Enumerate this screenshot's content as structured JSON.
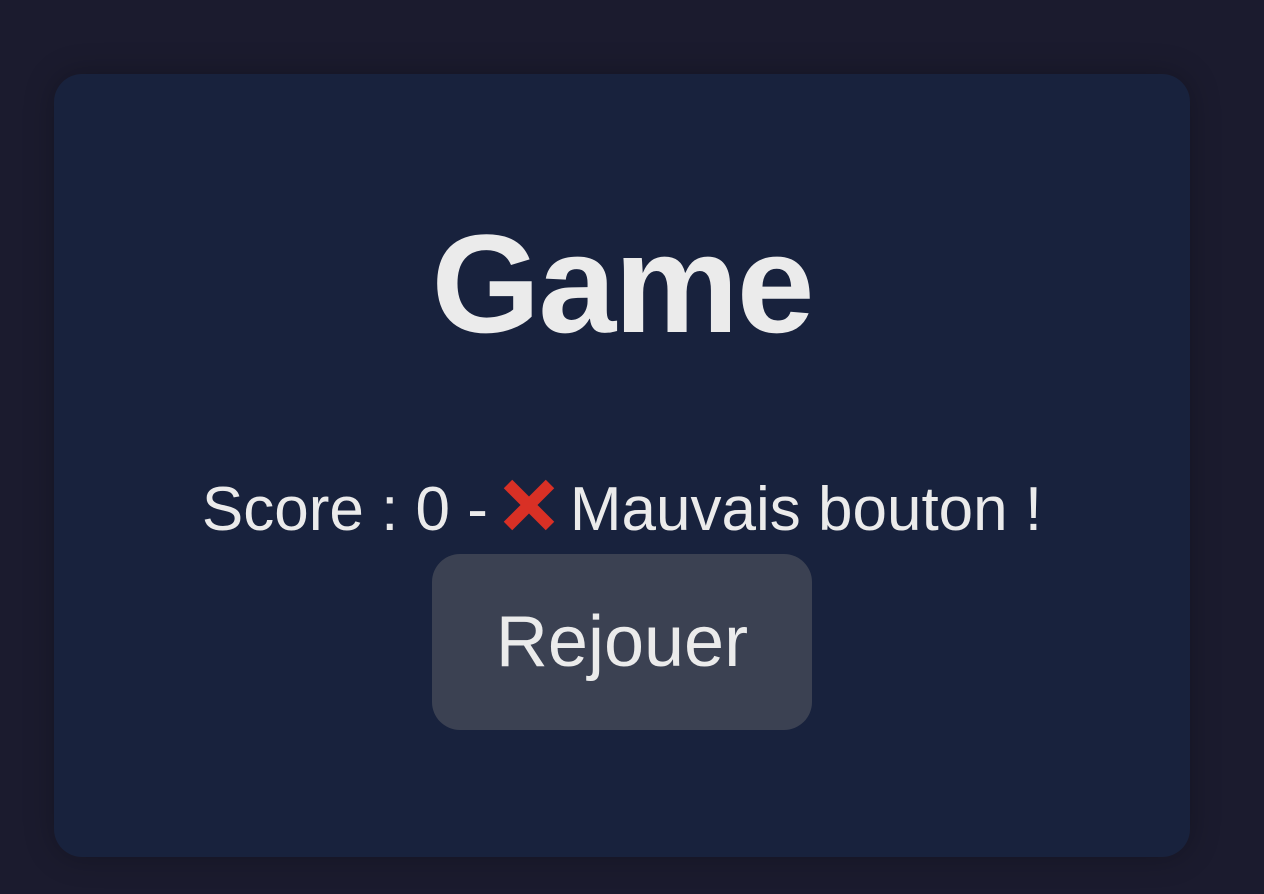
{
  "game": {
    "title": "Game",
    "score_prefix": "Score : 0 -",
    "message": "Mauvais bouton !",
    "status_icon": "cross-mark-icon",
    "replay_label": "Rejouer"
  },
  "colors": {
    "background": "#1b1b2e",
    "card": "#18223d",
    "text": "#ebebeb",
    "button": "#3b4152",
    "error": "#d93025"
  }
}
